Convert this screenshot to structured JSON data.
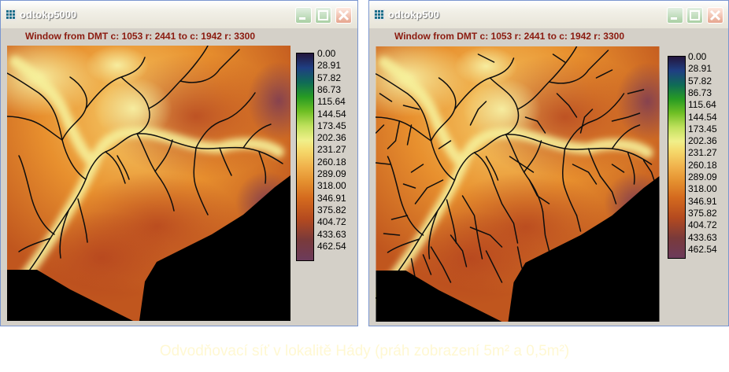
{
  "windows": [
    {
      "title": "odtokp5000",
      "caption": "Window from DMT c: 1053 r: 2441 to c: 1942 r: 3300"
    },
    {
      "title": "odtokp500",
      "caption": "Window from DMT c: 1053 r: 2441 to c: 1942 r: 3300"
    }
  ],
  "legend": [
    "0.00",
    "28.91",
    "57.82",
    "86.73",
    "115.64",
    "144.54",
    "173.45",
    "202.36",
    "231.27",
    "260.18",
    "289.09",
    "318.00",
    "346.91",
    "375.82",
    "404.72",
    "433.63",
    "462.54"
  ],
  "footer": "Odvodňovací síť v lokalitě Hády (práh zobrazení 5m² a 0,5m²)",
  "colors": {
    "title_text": "#ffffff",
    "caption": "#8b1a0f",
    "footer": "#fff8d2",
    "window_bg": "#d4d0c8"
  },
  "icons": {
    "app": "grid-app-icon",
    "minimize": "minimize-icon",
    "maximize": "maximize-icon",
    "close": "close-icon"
  }
}
